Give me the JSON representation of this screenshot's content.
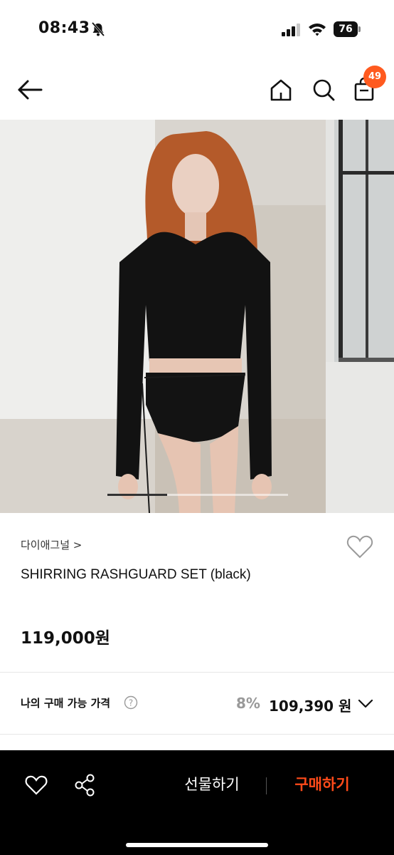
{
  "status_bar": {
    "time": "08:43",
    "battery": "76"
  },
  "header": {
    "cart_count": "49"
  },
  "product": {
    "brand": "다이애그널",
    "brand_chevron": ">",
    "name": "SHIRRING RASHGUARD SET (black)",
    "price": "119,000원",
    "image_count_hint": "carousel"
  },
  "my_price": {
    "label": "나의 구매 가능 가격",
    "help": "?",
    "discount": "8%",
    "price": "109,390 원"
  },
  "bottom_bar": {
    "gift_label": "선물하기",
    "buy_label": "구매하기"
  },
  "colors": {
    "accent": "#ff5a1f",
    "buy": "#ff4b1a"
  }
}
